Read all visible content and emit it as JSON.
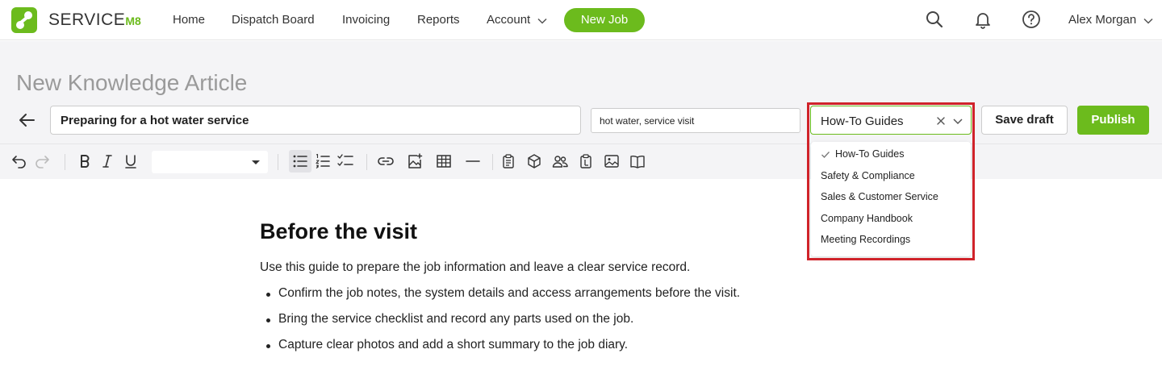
{
  "app": {
    "logo_text": "SERVICE",
    "logo_suffix": "M8",
    "brand_color": "#6cbb1d",
    "highlight_color": "#d0232a"
  },
  "nav": {
    "home": "Home",
    "dispatch": "Dispatch Board",
    "invoicing": "Invoicing",
    "reports": "Reports",
    "account": "Account",
    "new_job": "New Job",
    "user_name": "Alex Morgan"
  },
  "editor": {
    "page_title": "New Knowledge Article",
    "title_value": "Preparing for a hot water service",
    "tags_value": "hot water, service visit",
    "category_value": "How-To Guides",
    "save_draft": "Save draft",
    "publish": "Publish",
    "font_value": ""
  },
  "category_menu": {
    "options": [
      {
        "label": "How-To Guides",
        "selected": true
      },
      {
        "label": "Safety & Compliance",
        "selected": false
      },
      {
        "label": "Sales & Customer Service",
        "selected": false
      },
      {
        "label": "Company Handbook",
        "selected": false
      },
      {
        "label": "Meeting Recordings",
        "selected": false
      }
    ]
  },
  "toolbar_icons": [
    "undo-icon",
    "redo-icon",
    "bold-icon",
    "italic-icon",
    "underline-icon",
    "bullet-list-icon",
    "numbered-list-icon",
    "checklist-icon",
    "link-icon",
    "insert-image-icon",
    "table-icon",
    "horizontal-rule-icon",
    "clipboard-icon",
    "package-icon",
    "users-icon",
    "clipboard-list-icon",
    "photo-icon",
    "book-icon"
  ],
  "content": {
    "heading": "Before the visit",
    "intro": "Use this guide to prepare the job information and leave a clear service record.",
    "bullets": [
      "Confirm the job notes, the system details and access arrangements before the visit.",
      "Bring the service checklist and record any parts used on the job.",
      "Capture clear photos and add a short summary to the job diary."
    ]
  }
}
